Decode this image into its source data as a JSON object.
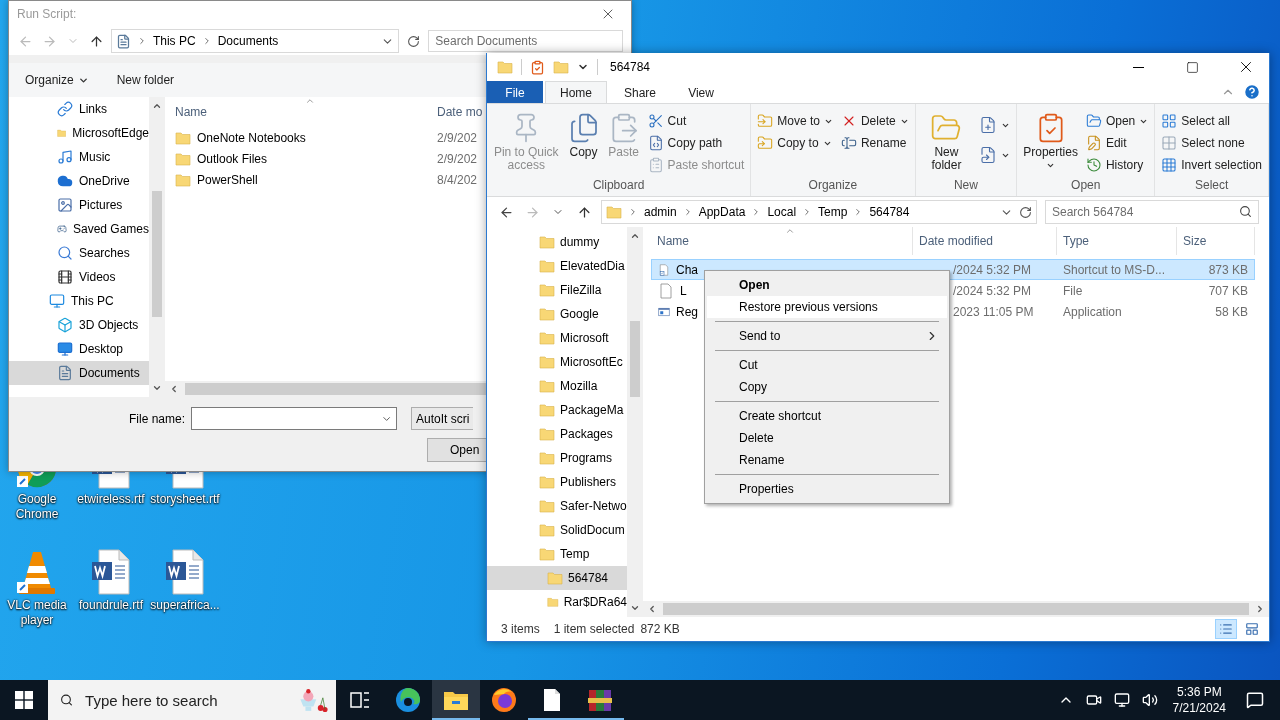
{
  "desktop_icons": [
    {
      "label": "Google Chrome",
      "kind": "chrome"
    },
    {
      "label": "etwireless.rtf",
      "kind": "document"
    },
    {
      "label": "storysheet.rtf",
      "kind": "document"
    },
    {
      "label": "VLC media player",
      "kind": "vlc"
    },
    {
      "label": "foundrule.rtf",
      "kind": "document"
    },
    {
      "label": "superafrica...",
      "kind": "document"
    }
  ],
  "run_dialog": {
    "title": "Run Script:",
    "path": [
      "This PC",
      "Documents"
    ],
    "search": {
      "placeholder": "Search Documents"
    },
    "toolbar": [
      {
        "label": "Organize",
        "dropdown": true
      },
      {
        "label": "New folder",
        "dropdown": false
      }
    ],
    "nav": [
      {
        "label": "Links",
        "kind": "links",
        "selected": false
      },
      {
        "label": "MicrosoftEdge",
        "kind": "folder",
        "selected": false
      },
      {
        "label": "Music",
        "kind": "music",
        "selected": false
      },
      {
        "label": "OneDrive",
        "kind": "cloud",
        "selected": false
      },
      {
        "label": "Pictures",
        "kind": "pictures",
        "selected": false
      },
      {
        "label": "Saved Games",
        "kind": "games",
        "selected": false
      },
      {
        "label": "Searches",
        "kind": "search",
        "selected": false
      },
      {
        "label": "Videos",
        "kind": "videos",
        "selected": false
      },
      {
        "label": "This PC",
        "kind": "pc",
        "selected": false,
        "children": [
          {
            "label": "3D Objects",
            "kind": "objects",
            "selected": false
          },
          {
            "label": "Desktop",
            "kind": "desktop",
            "selected": false
          },
          {
            "label": "Documents",
            "kind": "documents",
            "selected": true
          }
        ]
      }
    ],
    "columns": [
      "Name",
      "Date mo"
    ],
    "files": [
      {
        "name": "OneNote Notebooks",
        "date": "2/9/202"
      },
      {
        "name": "Outlook Files",
        "date": "2/9/202"
      },
      {
        "name": "PowerShell",
        "date": "8/4/202"
      }
    ],
    "file_name": {
      "label": "File name:"
    },
    "file_type": "AutoIt scri",
    "buttons": [
      "Open"
    ]
  },
  "explorer": {
    "title": "564784",
    "tabs": [
      {
        "label": "File",
        "kind": "file",
        "selected": false
      },
      {
        "label": "Home",
        "kind": "tab",
        "selected": true
      },
      {
        "label": "Share",
        "kind": "tab",
        "selected": false
      },
      {
        "label": "View",
        "kind": "tab",
        "selected": false
      }
    ],
    "ribbon": [
      {
        "label": "Clipboard",
        "columns": [
          [
            {
              "label": "Pin to Quick access",
              "kind": "large",
              "disabled": true,
              "dropdown": false
            }
          ],
          [
            {
              "label": "Copy",
              "kind": "large",
              "disabled": false,
              "dropdown": false
            }
          ],
          [
            {
              "label": "Paste",
              "kind": "large",
              "disabled": true,
              "dropdown": false
            }
          ],
          [
            {
              "label": "Cut",
              "kind": "small",
              "disabled": false,
              "dropdown": false
            },
            {
              "label": "Copy path",
              "kind": "small",
              "disabled": false,
              "dropdown": false
            },
            {
              "label": "Paste shortcut",
              "kind": "small",
              "disabled": true,
              "dropdown": false
            }
          ]
        ]
      },
      {
        "label": "Organize",
        "columns": [
          [
            {
              "label": "Move to",
              "kind": "small",
              "disabled": false,
              "dropdown": true
            },
            {
              "label": "Copy to",
              "kind": "small",
              "disabled": false,
              "dropdown": true
            }
          ],
          [
            {
              "label": "Delete",
              "kind": "small",
              "disabled": false,
              "dropdown": true
            },
            {
              "label": "Rename",
              "kind": "small",
              "disabled": false,
              "dropdown": false
            }
          ]
        ]
      },
      {
        "label": "New",
        "columns": [
          [
            {
              "label": "New folder",
              "kind": "large",
              "disabled": false,
              "dropdown": false
            }
          ],
          [
            {
              "kind": "icon",
              "disabled": false,
              "dropdown": true
            },
            {
              "kind": "icon",
              "disabled": false,
              "dropdown": true
            }
          ]
        ]
      },
      {
        "label": "Open",
        "columns": [
          [
            {
              "label": "Properties",
              "kind": "large",
              "disabled": false,
              "dropdown": true
            }
          ],
          [
            {
              "label": "Open",
              "kind": "small",
              "disabled": false,
              "dropdown": true
            },
            {
              "label": "Edit",
              "kind": "small",
              "disabled": false,
              "dropdown": false
            },
            {
              "label": "History",
              "kind": "small",
              "disabled": false,
              "dropdown": false
            }
          ]
        ]
      },
      {
        "label": "Select",
        "columns": [
          [
            {
              "label": "Select all",
              "kind": "small",
              "disabled": false,
              "dropdown": false
            },
            {
              "label": "Select none",
              "kind": "small",
              "disabled": false,
              "dropdown": false
            },
            {
              "label": "Invert selection",
              "kind": "small",
              "disabled": false,
              "dropdown": false
            }
          ]
        ]
      }
    ],
    "address": [
      "admin",
      "AppData",
      "Local",
      "Temp",
      "564784"
    ],
    "search": {
      "placeholder": "Search 564784"
    },
    "tree": [
      {
        "label": "dummy",
        "selected": false
      },
      {
        "label": "ElevatedDia",
        "selected": false
      },
      {
        "label": "FileZilla",
        "selected": false
      },
      {
        "label": "Google",
        "selected": false
      },
      {
        "label": "Microsoft",
        "selected": false
      },
      {
        "label": "MicrosoftEc",
        "selected": false
      },
      {
        "label": "Mozilla",
        "selected": false
      },
      {
        "label": "PackageMa",
        "selected": false
      },
      {
        "label": "Packages",
        "selected": false
      },
      {
        "label": "Programs",
        "selected": false
      },
      {
        "label": "Publishers",
        "selected": false
      },
      {
        "label": "Safer-Netwo",
        "selected": false
      },
      {
        "label": "SolidDocum",
        "selected": false
      },
      {
        "label": "Temp",
        "selected": false,
        "children": [
          {
            "label": "564784",
            "selected": true
          },
          {
            "label": "Rar$DRa64",
            "selected": false
          }
        ]
      }
    ],
    "columns": [
      "Name",
      "Date modified",
      "Type",
      "Size"
    ],
    "files": [
      {
        "name": "Cha",
        "date": "/2024 5:32 PM",
        "type": "Shortcut to MS-D...",
        "size": "873 KB",
        "kind": "shortcut",
        "selected": true
      },
      {
        "name": "L",
        "date": "/2024 5:32 PM",
        "type": "File",
        "size": "707 KB",
        "kind": "file",
        "selected": false
      },
      {
        "name": "Reg",
        "date": "2023 11:05 PM",
        "type": "Application",
        "size": "58 KB",
        "kind": "application",
        "selected": false
      }
    ],
    "context_menu": {
      "groups": [
        [
          {
            "label": "Open",
            "default": true,
            "selected": false
          },
          {
            "label": "Restore previous versions",
            "selected": true
          }
        ],
        [
          {
            "label": "Send to",
            "submenu": true,
            "selected": false
          }
        ],
        [
          {
            "label": "Cut",
            "selected": false
          },
          {
            "label": "Copy",
            "selected": false
          }
        ],
        [
          {
            "label": "Create shortcut",
            "selected": false
          },
          {
            "label": "Delete",
            "selected": false
          },
          {
            "label": "Rename",
            "selected": false
          }
        ],
        [
          {
            "label": "Properties",
            "selected": false
          }
        ]
      ]
    },
    "status": {
      "count": "3 items",
      "selection": "1 item selected",
      "size": "872 KB"
    },
    "views": [
      {
        "kind": "details",
        "selected": true
      },
      {
        "kind": "large-icons",
        "selected": false
      }
    ]
  },
  "taskbar": {
    "search": {
      "placeholder": "Type here to search"
    },
    "apps": [
      {
        "kind": "task-view",
        "running": false,
        "selected": false
      },
      {
        "kind": "edge",
        "running": false,
        "selected": false
      },
      {
        "kind": "explorer",
        "running": true,
        "selected": true
      },
      {
        "kind": "firefox",
        "running": false,
        "selected": false
      },
      {
        "kind": "notepad",
        "running": true,
        "selected": false
      },
      {
        "kind": "winrar",
        "running": true,
        "selected": false
      }
    ],
    "time": "5:36 PM",
    "date": "7/21/2024"
  }
}
